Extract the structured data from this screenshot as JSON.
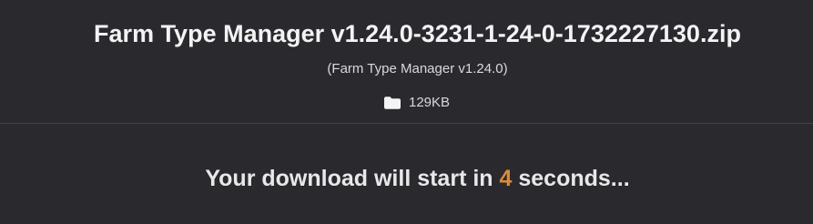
{
  "file": {
    "title": "Farm Type Manager v1.24.0-3231-1-24-0-1732227130.zip",
    "subtitle": "(Farm Type Manager v1.24.0)",
    "size": "129KB",
    "size_icon": "folder-icon"
  },
  "download": {
    "prefix": "Your download will start in ",
    "seconds": "4",
    "suffix": " seconds..."
  },
  "colors": {
    "background": "#2a292e",
    "text": "#f3f3f3",
    "accent": "#d98b3a",
    "divider": "#434249"
  }
}
